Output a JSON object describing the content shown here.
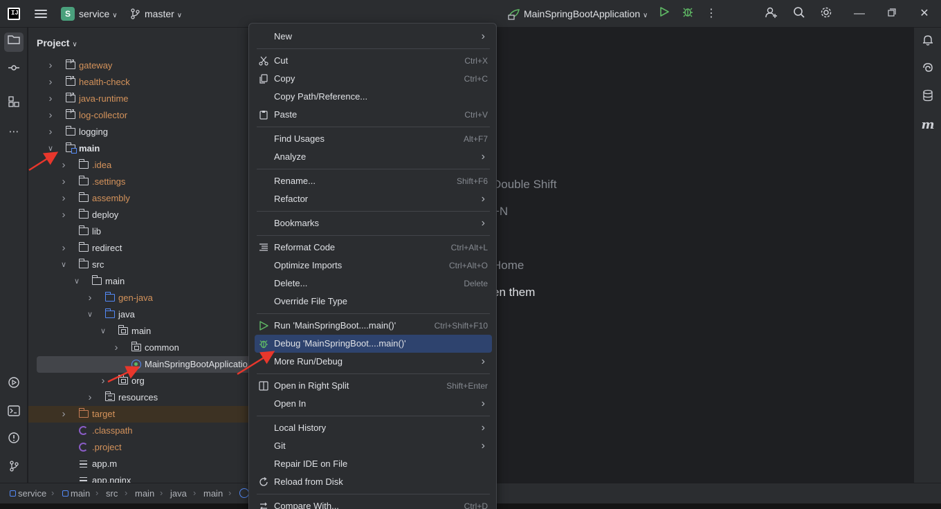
{
  "titlebar": {
    "project_badge": "S",
    "project_name": "service",
    "branch": "master",
    "run_config": "MainSpringBootApplication"
  },
  "project_panel": {
    "title": "Project",
    "tree": [
      {
        "label": "gateway",
        "color": "orange"
      },
      {
        "label": "health-check",
        "color": "orange"
      },
      {
        "label": "java-runtime",
        "color": "orange"
      },
      {
        "label": "log-collector",
        "color": "orange"
      },
      {
        "label": "logging",
        "color": "default"
      },
      {
        "label": "main",
        "color": "default"
      },
      {
        "label": ".idea",
        "color": "orange"
      },
      {
        "label": ".settings",
        "color": "orange"
      },
      {
        "label": "assembly",
        "color": "orange"
      },
      {
        "label": "deploy",
        "color": "default"
      },
      {
        "label": "lib",
        "color": "default"
      },
      {
        "label": "redirect",
        "color": "default"
      },
      {
        "label": "src",
        "color": "default"
      },
      {
        "label": "main",
        "color": "default"
      },
      {
        "label": "gen-java",
        "color": "orange"
      },
      {
        "label": "java",
        "color": "default"
      },
      {
        "label": "main",
        "color": "default"
      },
      {
        "label": "common",
        "color": "default"
      },
      {
        "label": "MainSpringBootApplicatio",
        "color": "default"
      },
      {
        "label": "org",
        "color": "default"
      },
      {
        "label": "resources",
        "color": "default"
      },
      {
        "label": "target",
        "color": "orange"
      },
      {
        "label": ".classpath",
        "color": "orange"
      },
      {
        "label": ".project",
        "color": "orange"
      },
      {
        "label": "app.m",
        "color": "default"
      },
      {
        "label": "app.nginx",
        "color": "default"
      }
    ]
  },
  "editor_hints": {
    "h1": "Double Shift",
    "h2": "+N",
    "h3": "Home",
    "h4": "en them"
  },
  "context_menu": {
    "items": [
      {
        "label": "New",
        "shortcut": "",
        "submenu": true,
        "icon": ""
      },
      {
        "label": "Cut",
        "shortcut": "Ctrl+X",
        "submenu": false,
        "icon": "scissors-icon"
      },
      {
        "label": "Copy",
        "shortcut": "Ctrl+C",
        "submenu": false,
        "icon": "copy-icon"
      },
      {
        "label": "Copy Path/Reference...",
        "shortcut": "",
        "submenu": false,
        "icon": ""
      },
      {
        "label": "Paste",
        "shortcut": "Ctrl+V",
        "submenu": false,
        "icon": "paste-icon"
      },
      {
        "label": "Find Usages",
        "shortcut": "Alt+F7",
        "submenu": false,
        "icon": ""
      },
      {
        "label": "Analyze",
        "shortcut": "",
        "submenu": true,
        "icon": ""
      },
      {
        "label": "Rename...",
        "shortcut": "Shift+F6",
        "submenu": false,
        "icon": ""
      },
      {
        "label": "Refactor",
        "shortcut": "",
        "submenu": true,
        "icon": ""
      },
      {
        "label": "Bookmarks",
        "shortcut": "",
        "submenu": true,
        "icon": ""
      },
      {
        "label": "Reformat Code",
        "shortcut": "Ctrl+Alt+L",
        "submenu": false,
        "icon": "reformat-icon"
      },
      {
        "label": "Optimize Imports",
        "shortcut": "Ctrl+Alt+O",
        "submenu": false,
        "icon": ""
      },
      {
        "label": "Delete...",
        "shortcut": "Delete",
        "submenu": false,
        "icon": ""
      },
      {
        "label": "Override File Type",
        "shortcut": "",
        "submenu": false,
        "icon": ""
      },
      {
        "label": "Run 'MainSpringBoot....main()'",
        "shortcut": "Ctrl+Shift+F10",
        "submenu": false,
        "icon": "run-icon"
      },
      {
        "label": "Debug 'MainSpringBoot....main()'",
        "shortcut": "",
        "submenu": false,
        "icon": "debug-icon"
      },
      {
        "label": "More Run/Debug",
        "shortcut": "",
        "submenu": true,
        "icon": ""
      },
      {
        "label": "Open in Right Split",
        "shortcut": "Shift+Enter",
        "submenu": false,
        "icon": "split-icon"
      },
      {
        "label": "Open In",
        "shortcut": "",
        "submenu": true,
        "icon": ""
      },
      {
        "label": "Local History",
        "shortcut": "",
        "submenu": true,
        "icon": ""
      },
      {
        "label": "Git",
        "shortcut": "",
        "submenu": true,
        "icon": ""
      },
      {
        "label": "Repair IDE on File",
        "shortcut": "",
        "submenu": false,
        "icon": ""
      },
      {
        "label": "Reload from Disk",
        "shortcut": "",
        "submenu": false,
        "icon": "reload-icon"
      },
      {
        "label": "Compare With...",
        "shortcut": "Ctrl+D",
        "submenu": false,
        "icon": "compare-icon"
      }
    ]
  },
  "statusbar": {
    "crumbs": [
      "service",
      "main",
      "src",
      "main",
      "java",
      "main"
    ]
  },
  "colors": {
    "accent": "#2e436e",
    "folder_excluded": "#d5935b",
    "run_green": "#5fb865",
    "annotation_red": "#e8372c"
  }
}
